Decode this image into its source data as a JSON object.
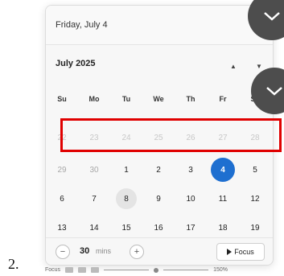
{
  "header": {
    "selected_date": "Friday, July 4"
  },
  "calendar": {
    "month_label": "July 2025",
    "nav_up_symbol": "▲",
    "nav_down_symbol": "▼",
    "weekdays": [
      "Su",
      "Mo",
      "Tu",
      "We",
      "Th",
      "Fr",
      "Sa"
    ],
    "weeks": [
      [
        "22",
        "23",
        "24",
        "25",
        "26",
        "27",
        "28"
      ],
      [
        "29",
        "30",
        "1",
        "2",
        "3",
        "4",
        "5"
      ],
      [
        "6",
        "7",
        "8",
        "9",
        "10",
        "11",
        "12"
      ],
      [
        "13",
        "14",
        "15",
        "16",
        "17",
        "18",
        "19"
      ]
    ],
    "today": "4"
  },
  "focus": {
    "minus": "−",
    "plus": "+",
    "minutes_value": "30",
    "minutes_unit": "mins",
    "button_label": "Focus"
  },
  "annotation": {
    "step_number": "2."
  },
  "taskbar": {
    "left_text": "Focus",
    "right_text": "150%"
  },
  "colors": {
    "accent": "#1e6fd0",
    "highlight": "#e00000",
    "overlay_button": "#4d4d4d"
  }
}
